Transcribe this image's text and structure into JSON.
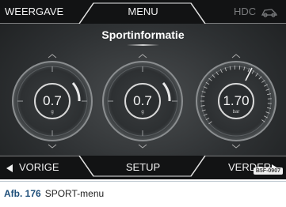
{
  "screen": {
    "title": "Sportinformatie",
    "top_tabs": {
      "left": "WEERGAVE",
      "center": "MENU",
      "right": "HDC"
    },
    "bottom_tabs": {
      "left": "VORIGE",
      "center": "SETUP",
      "right": "VERDER"
    },
    "gauges": [
      {
        "value": "0.7",
        "unit": "g"
      },
      {
        "value": "0.7",
        "unit": "g"
      },
      {
        "value": "1.70",
        "unit": "bar"
      }
    ],
    "image_code": "B5F-0907"
  },
  "caption": {
    "figure_label": "Afb. 176",
    "text": "SPORT-menu"
  },
  "icons": {
    "left_arrow": "triangle-left-icon",
    "right_arrow": "triangle-right-icon",
    "hdc": "hdc-vehicle-icon"
  },
  "colors": {
    "bar": "#121314",
    "text": "#f2f2f2",
    "disabled": "#7a7c7e",
    "accent": "#ffffff"
  }
}
